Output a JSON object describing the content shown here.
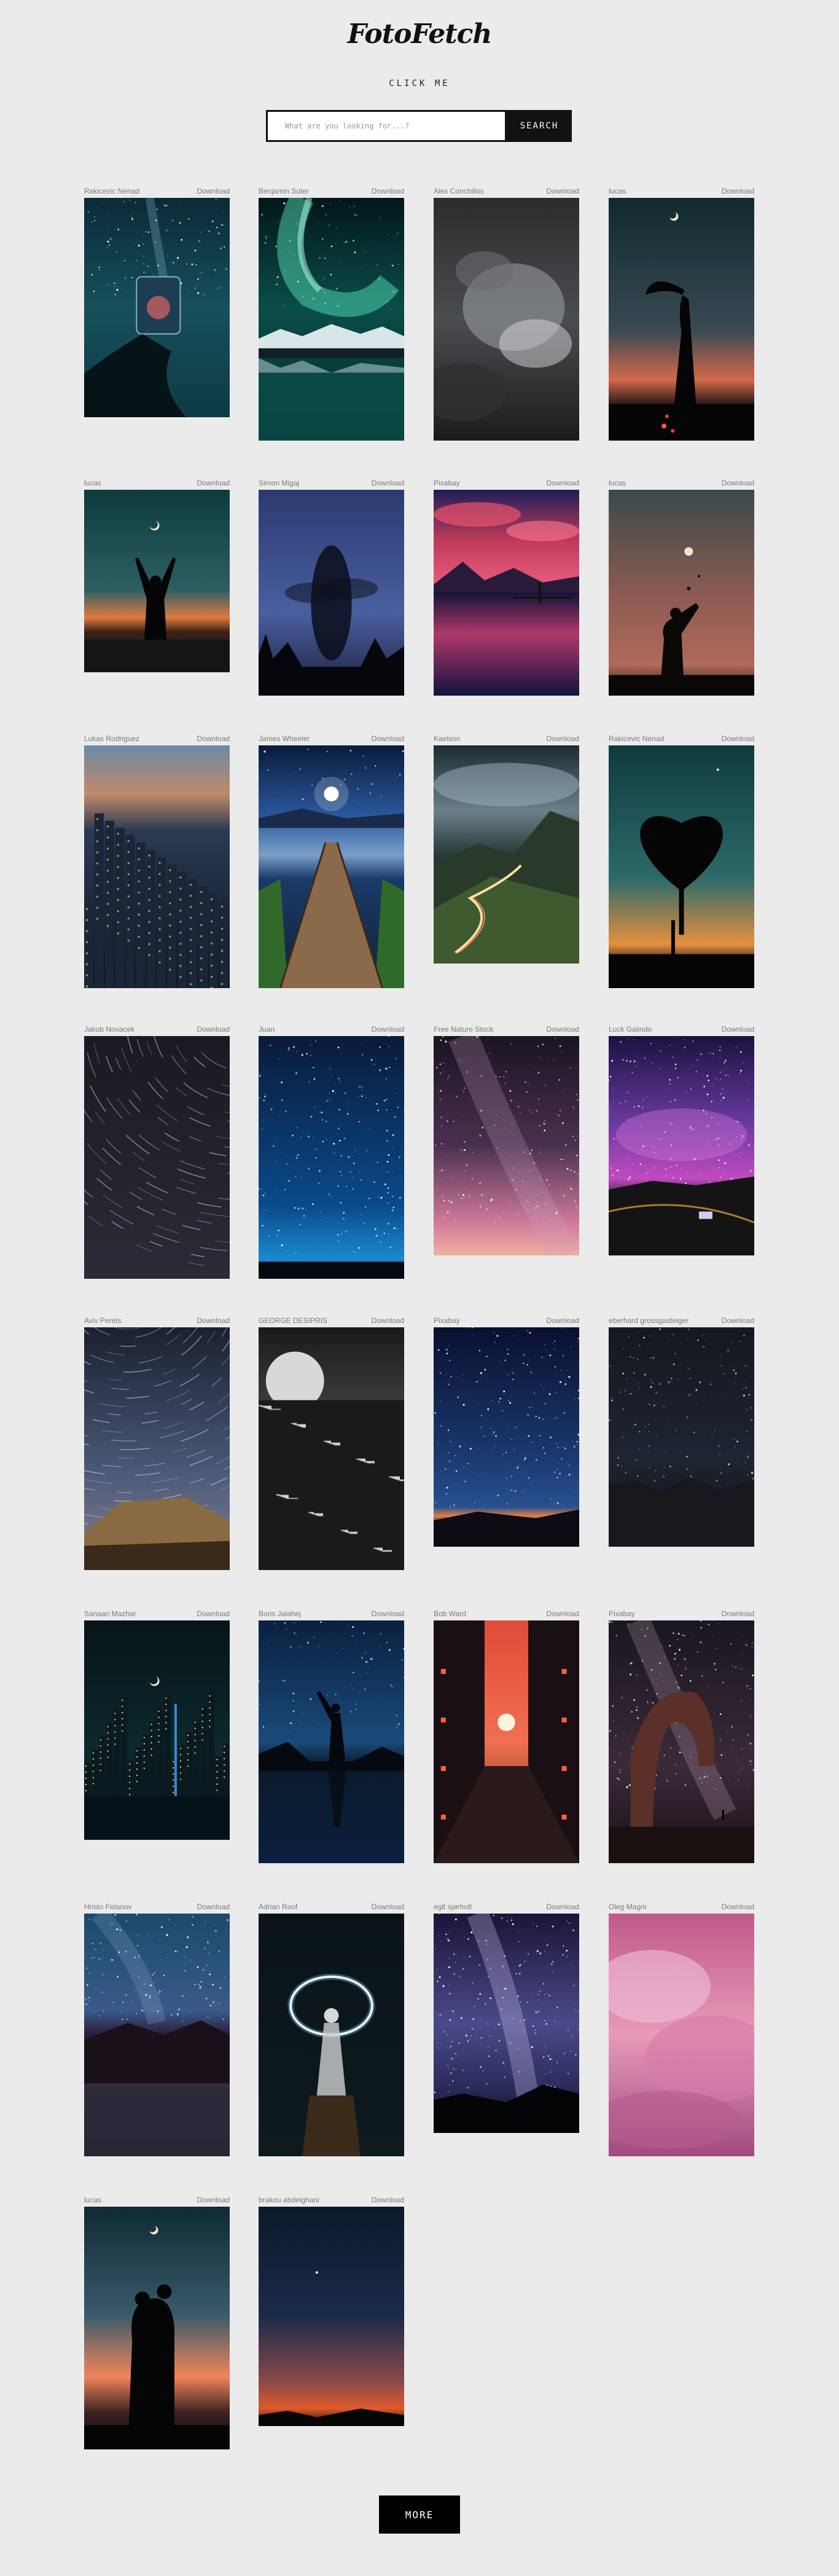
{
  "header": {
    "logo": "FotoFetch",
    "subtitle": "CLICK ME"
  },
  "search": {
    "placeholder": "What are you looking for...?",
    "value": "",
    "button_label": "SEARCH"
  },
  "download_label": "Download",
  "more_label": "MORE",
  "photos": [
    {
      "author": "Rakicevic Nenad",
      "scene": "jar-sky"
    },
    {
      "author": "Benjamin Suter",
      "scene": "aurora"
    },
    {
      "author": "Alex Conchillos",
      "scene": "clouds-bw"
    },
    {
      "author": "lucas",
      "scene": "dancer-moon"
    },
    {
      "author": "lucas",
      "scene": "hands-moon"
    },
    {
      "author": "Simon Migaj",
      "scene": "blur-figure"
    },
    {
      "author": "Pixabay",
      "scene": "lake-pink"
    },
    {
      "author": "lucas",
      "scene": "girl-moon"
    },
    {
      "author": "Lukas Rodriguez",
      "scene": "city"
    },
    {
      "author": "James Wheeler",
      "scene": "dock"
    },
    {
      "author": "Kaelson",
      "scene": "valley-road"
    },
    {
      "author": "Rakicevic Nenad",
      "scene": "heart-tree"
    },
    {
      "author": "Jakub Novacek",
      "scene": "startrails"
    },
    {
      "author": "Juan",
      "scene": "night-blue"
    },
    {
      "author": "Free Nature Stock",
      "scene": "milkyway-pink"
    },
    {
      "author": "Luck Galindo",
      "scene": "milkyway-purple"
    },
    {
      "author": "Aviv Perets",
      "scene": "startrails-mountain"
    },
    {
      "author": "GEORGE DESIPRIS",
      "scene": "moon-sea"
    },
    {
      "author": "Pixabay",
      "scene": "starry-blue"
    },
    {
      "author": "eberhard grossgasteiger",
      "scene": "dark-rocks"
    },
    {
      "author": "Sanaan Mazhar",
      "scene": "city-moon"
    },
    {
      "author": "Boris Jalahej",
      "scene": "woman-reflection"
    },
    {
      "author": "Bob Ward",
      "scene": "street-sunset"
    },
    {
      "author": "Pixabay",
      "scene": "arch"
    },
    {
      "author": "Hristo Fidanov",
      "scene": "mountain-lake"
    },
    {
      "author": "Adrian Roof",
      "scene": "light-ring"
    },
    {
      "author": "eglt sjørholt",
      "scene": "milkyway-forest"
    },
    {
      "author": "Oleg Magni",
      "scene": "pink-clouds"
    },
    {
      "author": "lucas",
      "scene": "couple-moon"
    },
    {
      "author": "brakou abdelghani",
      "scene": "sunset-gradient"
    }
  ],
  "colors": {
    "background": "#ebebeb",
    "button": "#111111",
    "meta_text": "#7a7a7a"
  }
}
